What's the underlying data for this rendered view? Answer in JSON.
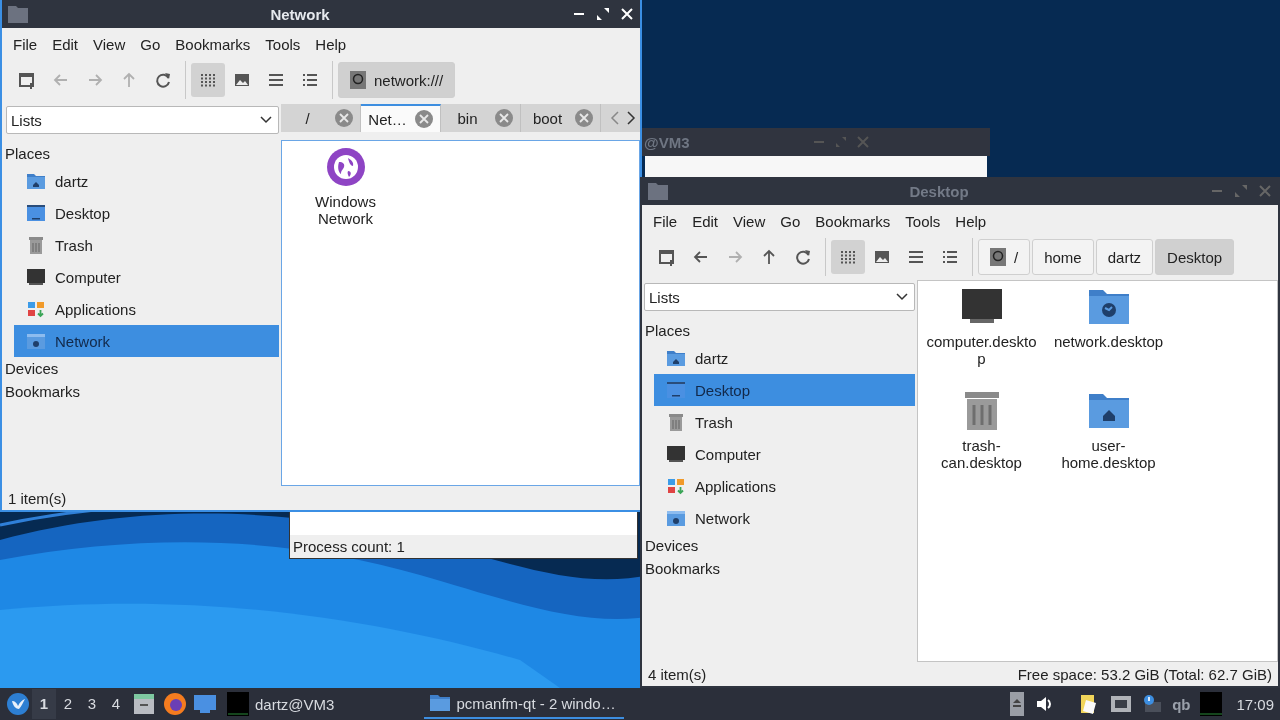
{
  "network_window": {
    "title": "Network",
    "focused": true,
    "menu": [
      "File",
      "Edit",
      "View",
      "Go",
      "Bookmarks",
      "Tools",
      "Help"
    ],
    "nav": [
      {
        "kind": "new-window",
        "disabled": false
      },
      {
        "kind": "back",
        "disabled": true
      },
      {
        "kind": "forward",
        "disabled": true
      },
      {
        "kind": "up",
        "disabled": true
      },
      {
        "kind": "reload",
        "disabled": false
      }
    ],
    "views": [
      {
        "kind": "icons",
        "selected": true
      },
      {
        "kind": "thumbnails",
        "selected": false
      },
      {
        "kind": "compact",
        "selected": false
      },
      {
        "kind": "details",
        "selected": false
      }
    ],
    "path_buttons": [
      {
        "label": "network:///",
        "kind": "root",
        "selected": true
      }
    ],
    "view_combo": "Lists",
    "tabs": [
      {
        "label": "/",
        "selected": false
      },
      {
        "label": "Net…",
        "selected": true
      },
      {
        "label": "bin",
        "selected": false
      },
      {
        "label": "boot",
        "selected": false
      }
    ],
    "sidebar": [
      {
        "title": "Places",
        "items": [
          {
            "label": "dartz",
            "kind": "home",
            "selected": false
          },
          {
            "label": "Desktop",
            "kind": "desktop",
            "selected": false
          },
          {
            "label": "Trash",
            "kind": "trash",
            "selected": false
          },
          {
            "label": "Computer",
            "kind": "computer",
            "selected": false
          },
          {
            "label": "Applications",
            "kind": "applications",
            "selected": false
          },
          {
            "label": "Network",
            "kind": "network",
            "selected": true
          }
        ]
      },
      {
        "title": "Devices"
      },
      {
        "title": "Bookmarks"
      }
    ],
    "files": [
      {
        "label": "Windows Network",
        "kind": "globe"
      }
    ],
    "status": "1 item(s)"
  },
  "terminal_window": {
    "title": "@VM3"
  },
  "progress_dialog": {
    "status": "Process count: 1"
  },
  "desktop_window": {
    "title": "Desktop",
    "focused": false,
    "menu": [
      "File",
      "Edit",
      "View",
      "Go",
      "Bookmarks",
      "Tools",
      "Help"
    ],
    "nav": [
      {
        "kind": "new-window",
        "disabled": false
      },
      {
        "kind": "back",
        "disabled": false
      },
      {
        "kind": "forward",
        "disabled": true
      },
      {
        "kind": "up",
        "disabled": false
      },
      {
        "kind": "reload",
        "disabled": false
      }
    ],
    "views": [
      {
        "kind": "icons",
        "selected": true
      },
      {
        "kind": "thumbnails",
        "selected": false
      },
      {
        "kind": "compact",
        "selected": false
      },
      {
        "kind": "details",
        "selected": false
      }
    ],
    "path_buttons": [
      {
        "label": "/",
        "kind": "root",
        "selected": false
      },
      {
        "label": "home",
        "kind": "dir",
        "selected": false
      },
      {
        "label": "dartz",
        "kind": "dir",
        "selected": false
      },
      {
        "label": "Desktop",
        "kind": "dir",
        "selected": true
      }
    ],
    "view_combo": "Lists",
    "sidebar": [
      {
        "title": "Places",
        "items": [
          {
            "label": "dartz",
            "kind": "home",
            "selected": false
          },
          {
            "label": "Desktop",
            "kind": "desktop",
            "selected": true
          },
          {
            "label": "Trash",
            "kind": "trash",
            "selected": false
          },
          {
            "label": "Computer",
            "kind": "computer",
            "selected": false
          },
          {
            "label": "Applications",
            "kind": "applications",
            "selected": false
          },
          {
            "label": "Network",
            "kind": "network",
            "selected": false
          }
        ]
      },
      {
        "title": "Devices"
      },
      {
        "title": "Bookmarks"
      }
    ],
    "files": [
      {
        "label": "computer.desktop",
        "kind": "monitor"
      },
      {
        "label": "network.desktop",
        "kind": "network-folder"
      },
      {
        "label": "trash-can.desktop",
        "kind": "trash"
      },
      {
        "label": "user-home.desktop",
        "kind": "home-folder"
      }
    ],
    "status": "4 item(s)",
    "free_space": "Free space: 53.2 GiB (Total: 62.7 GiB)"
  },
  "taskbar": {
    "workspaces": [
      {
        "label": "1",
        "selected": true
      },
      {
        "label": "2",
        "selected": false
      },
      {
        "label": "3",
        "selected": false
      },
      {
        "label": "4",
        "selected": false
      }
    ],
    "tasks": [
      {
        "label": "dartz@VM3",
        "kind": "terminal",
        "active": false
      },
      {
        "label": "pcmanfm-qt - 2 windo…",
        "kind": "folder",
        "active": true
      }
    ],
    "tray_label": "qb",
    "clock": "17:09"
  }
}
